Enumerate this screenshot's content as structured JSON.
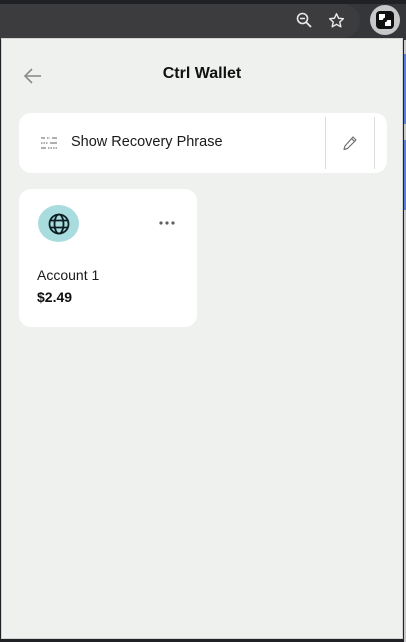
{
  "browser": {
    "zoom_icon": "zoom-out-icon",
    "bookmark_icon": "star-icon",
    "extension_icon": "ctrl-extension-icon"
  },
  "header": {
    "back_icon": "arrow-left-icon",
    "title": "Ctrl Wallet"
  },
  "recovery": {
    "icon": "phrase-icon",
    "label": "Show Recovery Phrase",
    "edit_icon": "pencil-icon"
  },
  "accounts": [
    {
      "name": "Account 1",
      "balance": "$2.49",
      "avatar_icon": "globe-icon",
      "avatar_color": "#a9dcdf",
      "menu_icon": "more-horizontal-icon"
    }
  ],
  "colors": {
    "background": "#eff1ee",
    "card": "#ffffff",
    "avatar": "#a9dcdf"
  }
}
